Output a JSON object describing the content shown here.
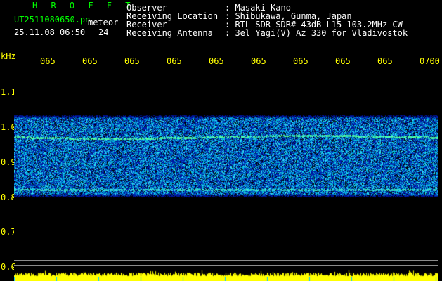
{
  "app": {
    "name": "H R O F F T",
    "filename": "UT2511080650.pn",
    "date_time": "25.11.08 06:50",
    "tag": "meteor",
    "count": "24_"
  },
  "info": {
    "rows": [
      {
        "label": "Observer",
        "value": ": Masaki Kano"
      },
      {
        "label": "Receiving Location",
        "value": ": Shibukawa, Gunma, Japan"
      },
      {
        "label": "Receiver",
        "value": ": RTL-SDR SDR# 43dB L15 103.2MHz CW"
      },
      {
        "label": "Receiving Antenna",
        "value": ": 3el Yagi(V) Az 330 for Vladivostok"
      }
    ]
  },
  "axis": {
    "y_unit": "kHz",
    "y_ticks": [
      "1.1",
      "1.0",
      "0.9",
      "0.8",
      "0.7",
      "0.6"
    ],
    "x_ticks": [
      "065",
      "065",
      "065",
      "065",
      "065",
      "065",
      "065",
      "065",
      "065",
      "0700"
    ]
  },
  "colors": {
    "background": "#000000",
    "title": "#00ff00",
    "axis": "#ffff00",
    "text": "#ffffff",
    "noise_low": "#0a1e8c",
    "noise_high": "#00ffff"
  },
  "bands": {
    "signal_khz": [
      0.985,
      0.8
    ]
  }
}
